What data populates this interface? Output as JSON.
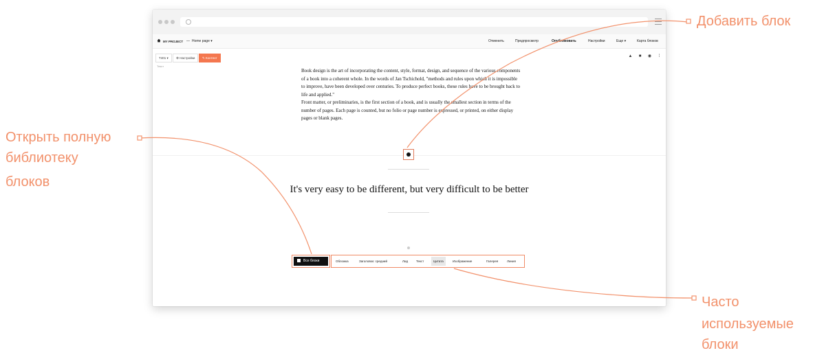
{
  "browser": {
    "menu_icon": "hamburger-icon"
  },
  "editor": {
    "project": "MY PROJECT",
    "page_separator": "—",
    "page": "Home page ▾",
    "nav": [
      "Отменить",
      "Предпросмотр",
      "Опубликовать",
      "Настройки",
      "Еще ▾",
      "Карта блоков"
    ],
    "toolbar": {
      "type_select": "T401 ▾",
      "settings": "⚙ Настройки",
      "content": "✎ Контент",
      "label": "Текст"
    },
    "tool_icons": [
      "move-up-icon",
      "delete-icon",
      "hide-icon",
      "more-icon"
    ],
    "accent": "#f4774f"
  },
  "content": {
    "paragraph1": "Book design is the art of incorporating the content, style, format, design, and sequence of the various components of a book into a coherent whole. In the words of Jan Tschichold, \"methods and rules upon which it is impossible to improve, have been developed over centuries. To produce perfect books, these rules have to be brought back to life and applied.\"",
    "paragraph2": "Front matter, or preliminaries, is the first section of a book, and is usually the smallest section in terms of the number of pages. Each page is counted, but no folio or page number is expressed, or printed, on either display pages or blank pages.",
    "quote": "It's very easy to be different, but very difficult to be better"
  },
  "blocks_bar": {
    "all_blocks": "Все блоки",
    "chips": [
      "Обложка",
      "Заголовок: средний",
      "Лид",
      "Текст",
      "Цитата",
      "Изображение",
      "Галерея",
      "Линия"
    ],
    "active_chip": "Цитата"
  },
  "annotations": {
    "add_block": "Добавить блок",
    "open_library": [
      "Открыть полную",
      "библиотеку",
      "блоков"
    ],
    "frequent": [
      "Часто",
      "используемые",
      "блоки"
    ],
    "color": "#f2916b"
  }
}
